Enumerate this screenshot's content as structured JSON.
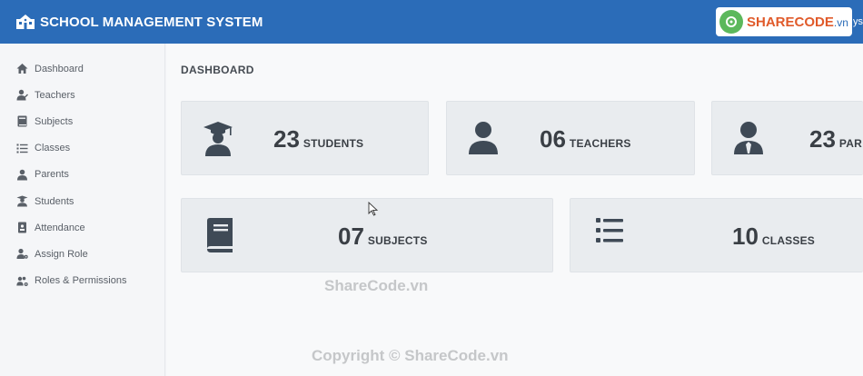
{
  "header": {
    "title": "SCHOOL MANAGEMENT SYSTEM",
    "user_text": "ys",
    "brand_color": "#2b6cb8"
  },
  "logo": {
    "text": "SHARECODE",
    "domain": ".vn"
  },
  "sidebar": {
    "items": [
      {
        "label": "Dashboard",
        "icon": "home-icon"
      },
      {
        "label": "Teachers",
        "icon": "user-tie-icon"
      },
      {
        "label": "Subjects",
        "icon": "book-icon"
      },
      {
        "label": "Classes",
        "icon": "list-icon"
      },
      {
        "label": "Parents",
        "icon": "user-icon"
      },
      {
        "label": "Students",
        "icon": "graduate-icon"
      },
      {
        "label": "Attendance",
        "icon": "id-badge-icon"
      },
      {
        "label": "Assign Role",
        "icon": "user-cog-icon"
      },
      {
        "label": "Roles & Permissions",
        "icon": "users-cog-icon"
      }
    ]
  },
  "main": {
    "page_title": "DASHBOARD",
    "cards": [
      {
        "count": "23",
        "label": "STUDENTS",
        "icon": "graduate-icon"
      },
      {
        "count": "06",
        "label": "TEACHERS",
        "icon": "user-icon"
      },
      {
        "count": "23",
        "label": "PAR",
        "icon": "user-tie-icon"
      },
      {
        "count": "07",
        "label": "SUBJECTS",
        "icon": "book-icon"
      },
      {
        "count": "10",
        "label": "CLASSES",
        "icon": "list-icon"
      }
    ]
  },
  "watermark": {
    "middle": "ShareCode.vn",
    "bottom": "Copyright © ShareCode.vn"
  }
}
